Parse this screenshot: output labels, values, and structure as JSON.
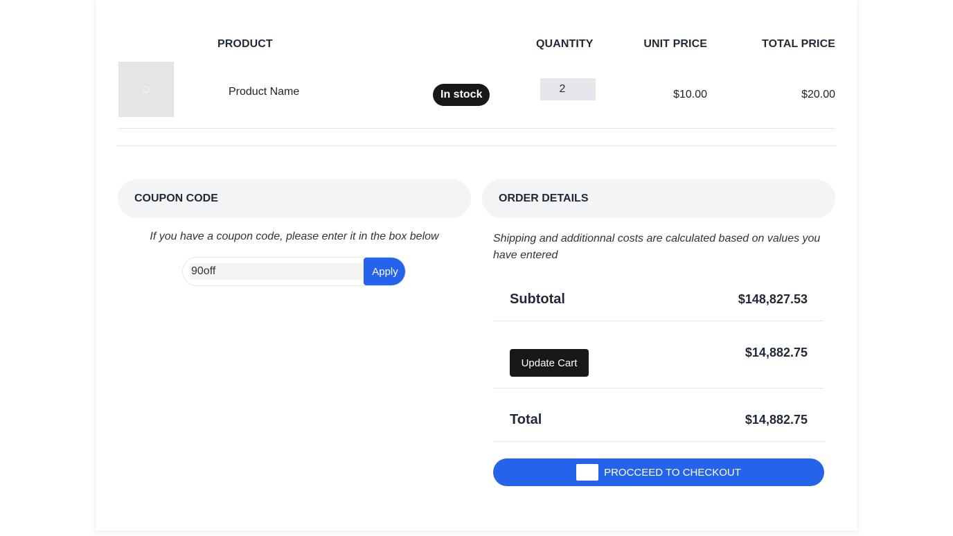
{
  "table": {
    "headers": {
      "product": "PRODUCT",
      "quantity": "QUANTITY",
      "unit_price": "UNIT PRICE",
      "total_price": "TOTAL PRICE"
    },
    "rows": [
      {
        "name": "Product Name",
        "stock_badge": "In stock",
        "quantity": "2",
        "unit_price": "$10.00",
        "total_price": "$20.00",
        "thumbnail_icon": "image-placeholder-icon"
      }
    ]
  },
  "coupon": {
    "title": "COUPON CODE",
    "note": "If you have a coupon code, please enter it in the box below",
    "input_value": "90off",
    "apply_label": "Apply"
  },
  "order": {
    "title": "ORDER DETAILS",
    "note": "Shipping and additionnal costs are calculated based on values you have entered",
    "subtotal_label": "Subtotal",
    "subtotal_value": "$148,827.53",
    "update_cart_label": "Update Cart",
    "shipping_value": "$14,882.75",
    "total_label": "Total",
    "total_value": "$14,882.75",
    "checkout_label": "PROCCEED TO CHECKOUT",
    "checkout_icon": "credit-card-icon"
  },
  "colors": {
    "accent": "#2563eb",
    "dark": "#18181b",
    "panel_bg": "#f3f4f6"
  }
}
